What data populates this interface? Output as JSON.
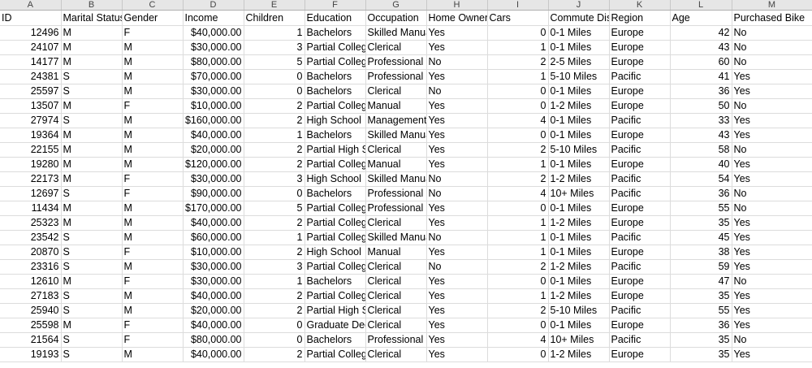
{
  "column_letters": [
    "A",
    "B",
    "C",
    "D",
    "E",
    "F",
    "G",
    "H",
    "I",
    "J",
    "K",
    "L",
    "M"
  ],
  "headers": [
    "ID",
    "Marital Status",
    "Gender",
    "Income",
    "Children",
    "Education",
    "Occupation",
    "Home Owner",
    "Cars",
    "Commute Distance",
    "Region",
    "Age",
    "Purchased Bike"
  ],
  "rows": [
    [
      "12496",
      "M",
      "F",
      "$40,000.00",
      "1",
      "Bachelors",
      "Skilled Manual",
      "Yes",
      "0",
      "0-1 Miles",
      "Europe",
      "42",
      "No"
    ],
    [
      "24107",
      "M",
      "M",
      "$30,000.00",
      "3",
      "Partial College",
      "Clerical",
      "Yes",
      "1",
      "0-1 Miles",
      "Europe",
      "43",
      "No"
    ],
    [
      "14177",
      "M",
      "M",
      "$80,000.00",
      "5",
      "Partial College",
      "Professional",
      "No",
      "2",
      "2-5 Miles",
      "Europe",
      "60",
      "No"
    ],
    [
      "24381",
      "S",
      "M",
      "$70,000.00",
      "0",
      "Bachelors",
      "Professional",
      "Yes",
      "1",
      "5-10 Miles",
      "Pacific",
      "41",
      "Yes"
    ],
    [
      "25597",
      "S",
      "M",
      "$30,000.00",
      "0",
      "Bachelors",
      "Clerical",
      "No",
      "0",
      "0-1 Miles",
      "Europe",
      "36",
      "Yes"
    ],
    [
      "13507",
      "M",
      "F",
      "$10,000.00",
      "2",
      "Partial College",
      "Manual",
      "Yes",
      "0",
      "1-2 Miles",
      "Europe",
      "50",
      "No"
    ],
    [
      "27974",
      "S",
      "M",
      "$160,000.00",
      "2",
      "High School",
      "Management",
      "Yes",
      "4",
      "0-1 Miles",
      "Pacific",
      "33",
      "Yes"
    ],
    [
      "19364",
      "M",
      "M",
      "$40,000.00",
      "1",
      "Bachelors",
      "Skilled Manual",
      "Yes",
      "0",
      "0-1 Miles",
      "Europe",
      "43",
      "Yes"
    ],
    [
      "22155",
      "M",
      "M",
      "$20,000.00",
      "2",
      "Partial High School",
      "Clerical",
      "Yes",
      "2",
      "5-10 Miles",
      "Pacific",
      "58",
      "No"
    ],
    [
      "19280",
      "M",
      "M",
      "$120,000.00",
      "2",
      "Partial College",
      "Manual",
      "Yes",
      "1",
      "0-1 Miles",
      "Europe",
      "40",
      "Yes"
    ],
    [
      "22173",
      "M",
      "F",
      "$30,000.00",
      "3",
      "High School",
      "Skilled Manual",
      "No",
      "2",
      "1-2 Miles",
      "Pacific",
      "54",
      "Yes"
    ],
    [
      "12697",
      "S",
      "F",
      "$90,000.00",
      "0",
      "Bachelors",
      "Professional",
      "No",
      "4",
      "10+ Miles",
      "Pacific",
      "36",
      "No"
    ],
    [
      "11434",
      "M",
      "M",
      "$170,000.00",
      "5",
      "Partial College",
      "Professional",
      "Yes",
      "0",
      "0-1 Miles",
      "Europe",
      "55",
      "No"
    ],
    [
      "25323",
      "M",
      "M",
      "$40,000.00",
      "2",
      "Partial College",
      "Clerical",
      "Yes",
      "1",
      "1-2 Miles",
      "Europe",
      "35",
      "Yes"
    ],
    [
      "23542",
      "S",
      "M",
      "$60,000.00",
      "1",
      "Partial College",
      "Skilled Manual",
      "No",
      "1",
      "0-1 Miles",
      "Pacific",
      "45",
      "Yes"
    ],
    [
      "20870",
      "S",
      "F",
      "$10,000.00",
      "2",
      "High School",
      "Manual",
      "Yes",
      "1",
      "0-1 Miles",
      "Europe",
      "38",
      "Yes"
    ],
    [
      "23316",
      "S",
      "M",
      "$30,000.00",
      "3",
      "Partial College",
      "Clerical",
      "No",
      "2",
      "1-2 Miles",
      "Pacific",
      "59",
      "Yes"
    ],
    [
      "12610",
      "M",
      "F",
      "$30,000.00",
      "1",
      "Bachelors",
      "Clerical",
      "Yes",
      "0",
      "0-1 Miles",
      "Europe",
      "47",
      "No"
    ],
    [
      "27183",
      "S",
      "M",
      "$40,000.00",
      "2",
      "Partial College",
      "Clerical",
      "Yes",
      "1",
      "1-2 Miles",
      "Europe",
      "35",
      "Yes"
    ],
    [
      "25940",
      "S",
      "M",
      "$20,000.00",
      "2",
      "Partial High School",
      "Clerical",
      "Yes",
      "2",
      "5-10 Miles",
      "Pacific",
      "55",
      "Yes"
    ],
    [
      "25598",
      "M",
      "F",
      "$40,000.00",
      "0",
      "Graduate Degree",
      "Clerical",
      "Yes",
      "0",
      "0-1 Miles",
      "Europe",
      "36",
      "Yes"
    ],
    [
      "21564",
      "S",
      "F",
      "$80,000.00",
      "0",
      "Bachelors",
      "Professional",
      "Yes",
      "4",
      "10+ Miles",
      "Pacific",
      "35",
      "No"
    ],
    [
      "19193",
      "S",
      "M",
      "$40,000.00",
      "2",
      "Partial College",
      "Clerical",
      "Yes",
      "0",
      "1-2 Miles",
      "Europe",
      "35",
      "Yes"
    ]
  ],
  "column_align": [
    "num",
    "txt",
    "txt",
    "num",
    "num",
    "txt",
    "txt",
    "txt",
    "num",
    "txt",
    "txt",
    "num",
    "txt"
  ]
}
